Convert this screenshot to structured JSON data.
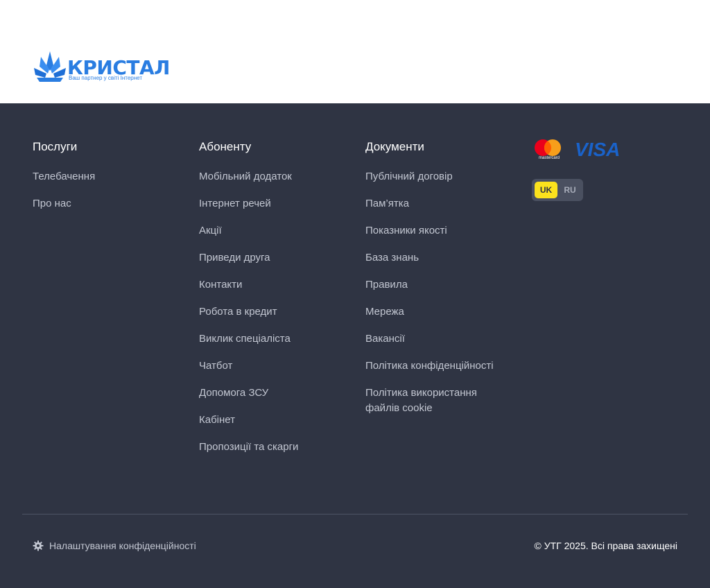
{
  "brand": {
    "name": "КРИСТАЛ",
    "tagline": "Ваш партнер у світі Інтернет",
    "color": "#2a7de1"
  },
  "columns": [
    {
      "title": "Послуги",
      "items": [
        "Телебачення",
        "Про нас"
      ]
    },
    {
      "title": "Абоненту",
      "items": [
        "Мобільний додаток",
        "Інтернет речей",
        "Акції",
        "Приведи друга",
        "Контакти",
        "Робота в кредит",
        "Виклик спеціаліста",
        "Чатбот",
        "Допомога ЗСУ",
        "Кабінет",
        "Пропозиції та скарги"
      ]
    },
    {
      "title": "Документи",
      "items": [
        "Публічний договір",
        "Пам’ятка",
        "Показники якості",
        "База знань",
        "Правила",
        "Мережа",
        "Вакансії",
        "Політика конфіденційності",
        "Політика використання файлів cookie"
      ]
    }
  ],
  "payments": {
    "mastercard_label": "mastercard",
    "visa_label": "VISA"
  },
  "language": {
    "options": [
      "UK",
      "RU"
    ],
    "selected": "UK",
    "accent_color": "#fbe21d"
  },
  "bottom": {
    "privacy_settings": "Налаштування конфіденційності",
    "copyright": "© УТГ 2025. Всі права захищені"
  },
  "colors": {
    "footer_bg": "#2f3443",
    "link_text": "#c3c7d2"
  }
}
